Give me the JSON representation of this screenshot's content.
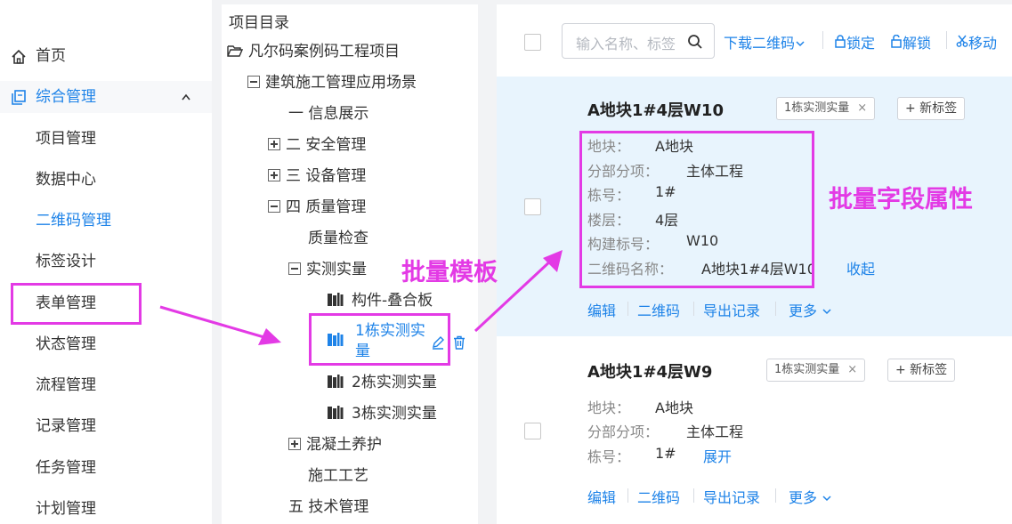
{
  "sidebar": {
    "items": [
      {
        "label": "首页",
        "icon": "home-icon"
      },
      {
        "label": "综合管理",
        "icon": "copy-icon"
      },
      {
        "label": "项目管理"
      },
      {
        "label": "数据中心"
      },
      {
        "label": "二维码管理"
      },
      {
        "label": "标签设计"
      },
      {
        "label": "表单管理"
      },
      {
        "label": "状态管理"
      },
      {
        "label": "流程管理"
      },
      {
        "label": "记录管理"
      },
      {
        "label": "任务管理"
      },
      {
        "label": "计划管理"
      }
    ],
    "chevron": "^"
  },
  "tree": {
    "header": "项目目录",
    "nodes": {
      "root": "凡尔码案例码工程项目",
      "scenario": "建筑施工管理应用场景",
      "info": "一 信息展示",
      "safety": "二 安全管理",
      "equipment": "三 设备管理",
      "quality": "四 质量管理",
      "quality_check": "质量检查",
      "measure": "实测实量",
      "tpl_component": "构件-叠合板",
      "tpl_1_line1": "1栋实测实",
      "tpl_1_line2": "量",
      "tpl_2": "2栋实测实量",
      "tpl_3": "3栋实测实量",
      "concrete": "混凝土养护",
      "craft": "施工工艺",
      "tech": "五 技术管理"
    }
  },
  "annotations": {
    "template": "批量模板",
    "fields": "批量字段属性"
  },
  "toolbar": {
    "search_placeholder": "输入名称、标签",
    "download": "下载二维码",
    "lock": "锁定",
    "unlock": "解锁",
    "move": "移动"
  },
  "cards": [
    {
      "title": "A地块1#4层W10",
      "tag": "1栋实测实量",
      "new_tag": "+ 新标签",
      "fields": [
        {
          "label": "地块：",
          "value": "A地块"
        },
        {
          "label": "分部分项：",
          "value": "主体工程"
        },
        {
          "label": "栋号：",
          "value": "1#"
        },
        {
          "label": "楼层：",
          "value": "4层"
        },
        {
          "label": "构建标号：",
          "value": "W10"
        },
        {
          "label": "二维码名称：",
          "value": "A地块1#4层W10"
        }
      ],
      "toggle": "收起",
      "actions": [
        "编辑",
        "二维码",
        "导出记录",
        "更多"
      ]
    },
    {
      "title": "A地块1#4层W9",
      "tag": "1栋实测实量",
      "new_tag": "+ 新标签",
      "fields": [
        {
          "label": "地块：",
          "value": "A地块"
        },
        {
          "label": "分部分项：",
          "value": "主体工程"
        },
        {
          "label": "栋号：",
          "value": "1#"
        }
      ],
      "toggle": "展开",
      "actions": [
        "编辑",
        "二维码",
        "导出记录",
        "更多"
      ]
    }
  ],
  "colors": {
    "accent": "#1e83e8",
    "annotation": "#e33ae5",
    "selected_card_bg": "#e8f4fd"
  }
}
